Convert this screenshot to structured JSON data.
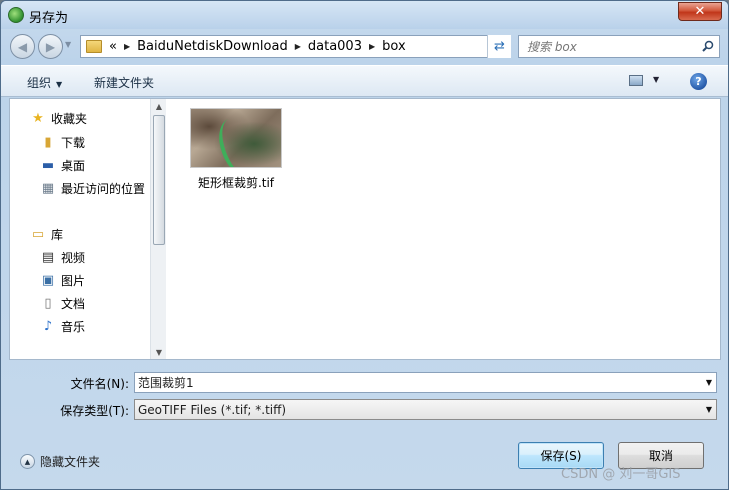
{
  "window": {
    "title": "另存为",
    "close_label": "✕"
  },
  "address": {
    "overflow": "«",
    "crumbs": [
      "BaiduNetdiskDownload",
      "data003",
      "box"
    ]
  },
  "search": {
    "placeholder": "搜索 box"
  },
  "toolbar": {
    "organize": "组织",
    "new_folder": "新建文件夹",
    "help": "?"
  },
  "nav": {
    "favorites": "收藏夹",
    "downloads": "下载",
    "desktop": "桌面",
    "recent": "最近访问的位置",
    "libraries": "库",
    "videos": "视频",
    "pictures": "图片",
    "documents": "文档",
    "music": "音乐"
  },
  "files": [
    {
      "name": "矩形框裁剪.tif"
    }
  ],
  "filename": {
    "label": "文件名(N):",
    "value": "范围裁剪1"
  },
  "filetype": {
    "label": "保存类型(T):",
    "value": "GeoTIFF Files (*.tif; *.tiff)"
  },
  "footer": {
    "hide_folders": "隐藏文件夹",
    "save": "保存(S)",
    "cancel": "取消",
    "watermark": "CSDN @ 刘一哥GIS"
  }
}
